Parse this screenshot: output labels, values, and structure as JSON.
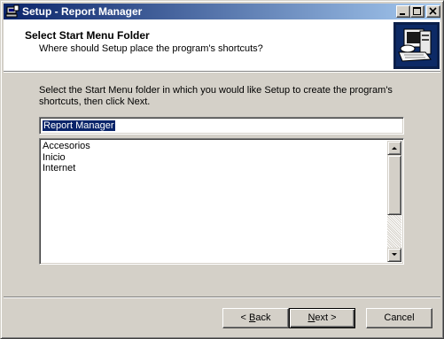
{
  "window": {
    "title": "Setup - Report Manager"
  },
  "header": {
    "title": "Select Start Menu Folder",
    "subtitle": "Where should Setup place the program's shortcuts?"
  },
  "instructions": "Select the Start Menu folder in which you would like Setup to create the program's shortcuts, then click Next.",
  "folder_input": {
    "value": "Report Manager"
  },
  "folder_list": {
    "items": [
      "Accesorios",
      "Inicio",
      "Internet"
    ]
  },
  "buttons": {
    "back": {
      "prefix": "< ",
      "accel": "B",
      "rest": "ack"
    },
    "next": {
      "accel": "N",
      "rest": "ext >"
    },
    "cancel": "Cancel"
  },
  "icons": {
    "app": "setup-app-icon",
    "minimize": "minimize-icon",
    "maximize": "maximize-icon",
    "close": "close-icon",
    "logo": "computer-install-icon"
  }
}
